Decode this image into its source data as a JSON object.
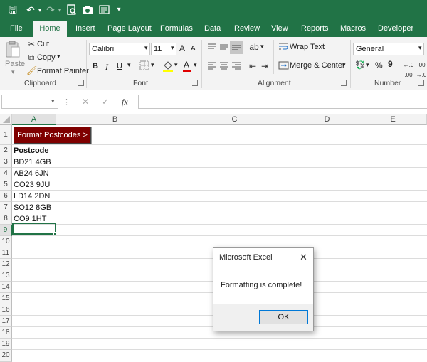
{
  "qat": {
    "icons": [
      "save-icon",
      "undo-icon",
      "redo-icon",
      "print-preview-icon",
      "camera-icon",
      "form-icon",
      "customize-qat-icon"
    ],
    "save_glyph": "🖫",
    "undo_glyph": "↶",
    "redo_glyph": "↷",
    "undo_dropdown": "▾",
    "redo_dropdown": "▾",
    "customize_glyph": "▾"
  },
  "tabs": [
    "File",
    "Home",
    "Insert",
    "Page Layout",
    "Formulas",
    "Data",
    "Review",
    "View",
    "Reports",
    "Macros",
    "Developer"
  ],
  "ribbon": {
    "clipboard": {
      "paste": "Paste",
      "cut": "Cut",
      "copy": "Copy",
      "format_painter": "Format Painter",
      "label": "Clipboard"
    },
    "font": {
      "name": "Calibri",
      "size": "11",
      "grow": "A",
      "shrink": "A",
      "bold": "B",
      "italic": "I",
      "underline": "U",
      "font_color_glyph": "A",
      "label": "Font"
    },
    "alignment": {
      "wrap_text": "Wrap Text",
      "merge_center": "Merge & Center",
      "label": "Alignment"
    },
    "number": {
      "format": "General",
      "percent": "%",
      "comma": "9",
      "label": "Number"
    }
  },
  "formula_bar": {
    "name_box": "",
    "cancel": "✕",
    "enter": "✓",
    "fx": "fx",
    "formula": ""
  },
  "sheet": {
    "columns": [
      "A",
      "B",
      "C",
      "D",
      "E"
    ],
    "rows": [
      "1",
      "2",
      "3",
      "4",
      "5",
      "6",
      "7",
      "8",
      "9",
      "10",
      "11",
      "12",
      "13",
      "14",
      "15",
      "16",
      "17",
      "18",
      "19",
      "20"
    ],
    "button_label": "Format Postcodes >",
    "header": "Postcode",
    "postcodes": [
      "BD21 4GB",
      "AB24 6JN",
      "CO23 9JU",
      "LD14 2DN",
      "SO12 8GB",
      "CO9 1HT"
    ],
    "selected_cell": "A9"
  },
  "dialog": {
    "title": "Microsoft Excel",
    "close_glyph": "✕",
    "message": "Formatting is complete!",
    "ok_label": "OK"
  },
  "colors": {
    "excel_green": "#217346",
    "button_red": "#7f0000"
  }
}
